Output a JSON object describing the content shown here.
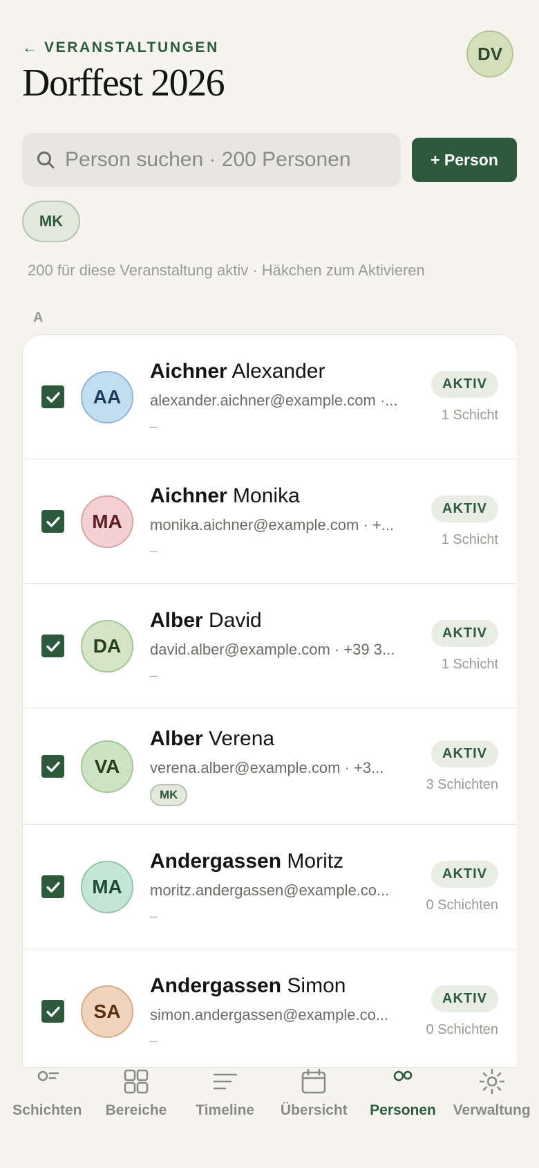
{
  "header": {
    "back_arrow": "←",
    "back_label": "VERANSTALTUNGEN",
    "title": "Dorffest 2026",
    "user_initials": "DV"
  },
  "search": {
    "placeholder": "Person suchen · 200 Personen",
    "add_button": "+ Person"
  },
  "filter_chip": "MK",
  "info_text": "200 für diese Veranstaltung aktiv · Häkchen zum Aktivieren",
  "section_letter": "A",
  "persons": [
    {
      "last": "Aichner",
      "first": "Alexander",
      "initials": "AA",
      "contact": "alexander.aichner@example.com ·...",
      "sub": "–",
      "status": "AKTIV",
      "shifts": "1 Schicht",
      "avatar_bg": "#c3ddf0",
      "avatar_border": "#8fb5d6",
      "avatar_fg": "#1e3a5a"
    },
    {
      "last": "Aichner",
      "first": "Monika",
      "initials": "MA",
      "contact": "monika.aichner@example.com · +...",
      "sub": "–",
      "status": "AKTIV",
      "shifts": "1 Schicht",
      "avatar_bg": "#f3d0d2",
      "avatar_border": "#d6a3a7",
      "avatar_fg": "#5a1e24"
    },
    {
      "last": "Alber",
      "first": "David",
      "initials": "DA",
      "contact": "david.alber@example.com · +39 3...",
      "sub": "–",
      "status": "AKTIV",
      "shifts": "1 Schicht",
      "avatar_bg": "#d3e5c4",
      "avatar_border": "#a6c495",
      "avatar_fg": "#243e1e"
    },
    {
      "last": "Alber",
      "first": "Verena",
      "initials": "VA",
      "contact": "verena.alber@example.com · +3...",
      "tag": "MK",
      "status": "AKTIV",
      "shifts": "3 Schichten",
      "avatar_bg": "#cde3c4",
      "avatar_border": "#a6c495",
      "avatar_fg": "#243e1e"
    },
    {
      "last": "Andergassen",
      "first": "Moritz",
      "initials": "MA",
      "contact": "moritz.andergassen@example.co...",
      "sub": "–",
      "status": "AKTIV",
      "shifts": "0 Schichten",
      "avatar_bg": "#c5e6d4",
      "avatar_border": "#93c4aa",
      "avatar_fg": "#1e4a32"
    },
    {
      "last": "Andergassen",
      "first": "Simon",
      "initials": "SA",
      "contact": "simon.andergassen@example.co...",
      "sub": "–",
      "status": "AKTIV",
      "shifts": "0 Schichten",
      "avatar_bg": "#f0d4bd",
      "avatar_border": "#d3ab8a",
      "avatar_fg": "#5a2e10"
    }
  ],
  "nav": [
    {
      "label": "Schichten",
      "icon": "person-list-icon",
      "active": false
    },
    {
      "label": "Bereiche",
      "icon": "grid-icon",
      "active": false
    },
    {
      "label": "Timeline",
      "icon": "timeline-icon",
      "active": false
    },
    {
      "label": "Übersicht",
      "icon": "calendar-icon",
      "active": false
    },
    {
      "label": "Personen",
      "icon": "people-icon",
      "active": true
    },
    {
      "label": "Verwaltung",
      "icon": "gear-icon",
      "active": false
    }
  ],
  "colors": {
    "accent": "#2d5a3d",
    "background": "#f6f4ee"
  }
}
